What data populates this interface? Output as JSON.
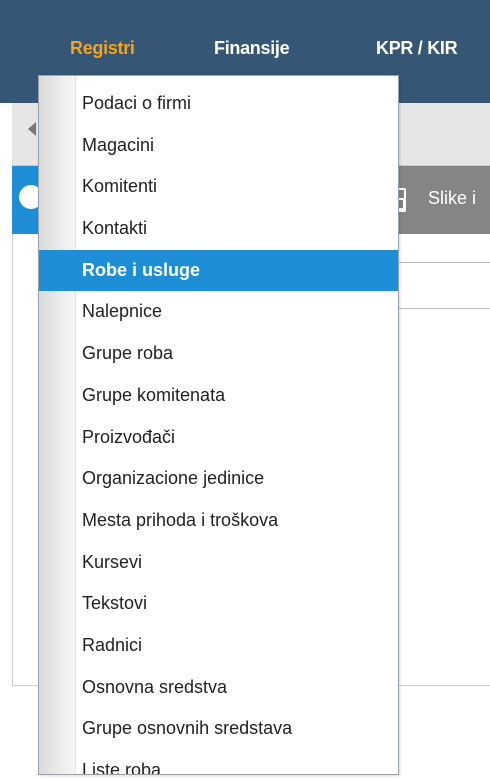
{
  "top_nav": {
    "items": [
      {
        "label": "Registri",
        "active": true
      },
      {
        "label": "Finansije",
        "active": false
      },
      {
        "label": "KPR / KIR",
        "active": false
      }
    ]
  },
  "toolbar": {
    "images_label": "Slike i"
  },
  "dropdown": {
    "items": [
      {
        "label": "Podaci o firmi"
      },
      {
        "label": "Magacini"
      },
      {
        "label": "Komitenti"
      },
      {
        "label": "Kontakti"
      },
      {
        "label": "Robe i usluge",
        "selected": true
      },
      {
        "label": "Nalepnice"
      },
      {
        "label": "Grupe roba"
      },
      {
        "label": "Grupe komitenata"
      },
      {
        "label": "Proizvođači"
      },
      {
        "label": "Organizacione jedinice"
      },
      {
        "label": "Mesta prihoda i troškova"
      },
      {
        "label": "Kursevi"
      },
      {
        "label": "Tekstovi"
      },
      {
        "label": "Radnici"
      },
      {
        "label": "Osnovna sredstva"
      },
      {
        "label": "Grupe osnovnih sredstava"
      },
      {
        "label": "Liste roba"
      }
    ]
  },
  "colors": {
    "header_bg": "#355775",
    "active_nav": "#f5a31a",
    "selected_item_bg": "#1e8fd6",
    "toolbar_bg": "#858585"
  },
  "icons": {
    "back": "chevron-left-icon",
    "images": "image-icon"
  }
}
